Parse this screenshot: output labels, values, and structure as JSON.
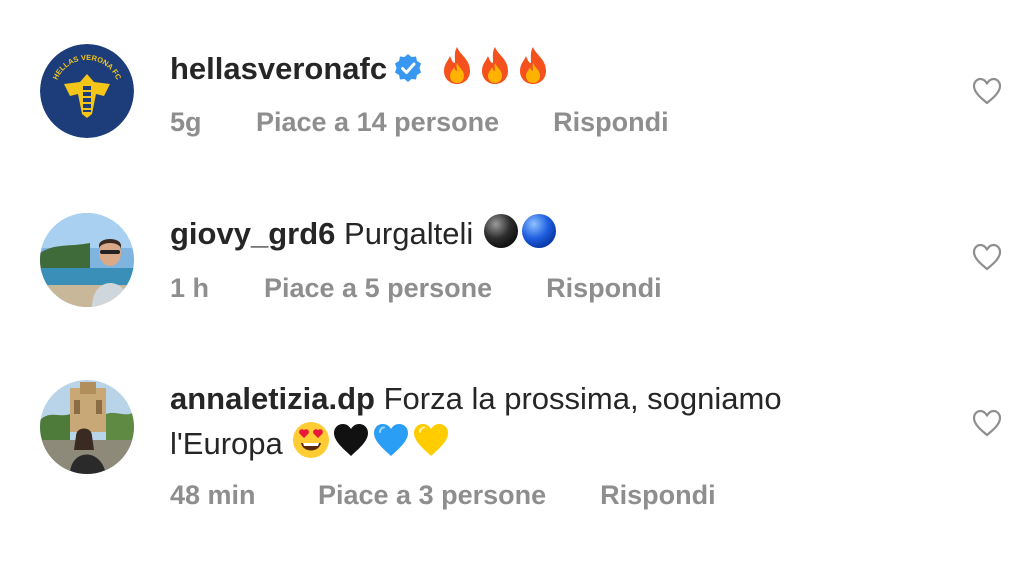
{
  "comments": [
    {
      "username": "hellasveronafc",
      "verified": true,
      "avatar_icon": "hellas-verona-crest",
      "avatar_text": "HELLAS VERONA FC",
      "text": "",
      "emojis": [
        "fire",
        "fire",
        "fire"
      ],
      "time": "5g",
      "likes": "Piace a 14 persone",
      "reply": "Rispondi"
    },
    {
      "username": "giovy_grd6",
      "verified": false,
      "avatar_icon": "user-photo-seaside",
      "text": "Purgalteli",
      "emojis": [
        "black-circle",
        "blue-circle"
      ],
      "time": "1 h",
      "likes": "Piace a 5 persone",
      "reply": "Rispondi"
    },
    {
      "username": "annaletizia.dp",
      "verified": false,
      "avatar_icon": "user-photo-park",
      "text_line1": "Forza la prossima, sogniamo",
      "text_line2": "l'Europa",
      "emojis": [
        "heart-eyes",
        "black-heart",
        "blue-heart",
        "yellow-heart"
      ],
      "time": "48 min",
      "likes": "Piace a 3 persone",
      "reply": "Rispondi"
    }
  ],
  "colors": {
    "text": "#262626",
    "meta": "#8e8e8e",
    "verified": "#3897f0",
    "verona_blue": "#1c3d7a",
    "verona_yellow": "#f5c518"
  }
}
